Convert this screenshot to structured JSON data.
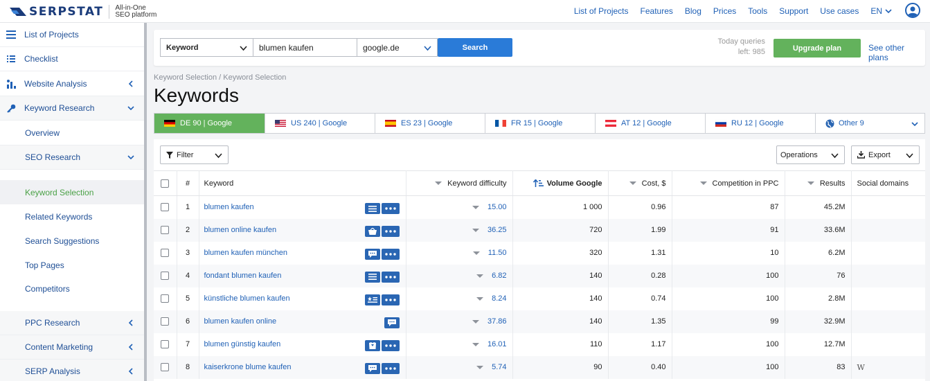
{
  "brand": {
    "name": "SERPSTAT",
    "tagline_1": "All-in-One",
    "tagline_2": "SEO platform"
  },
  "topnav": {
    "items": [
      "List of Projects",
      "Features",
      "Blog",
      "Prices",
      "Tools",
      "Support",
      "Use cases"
    ],
    "lang": "EN"
  },
  "sidebar": {
    "items": [
      {
        "label": "List of Projects"
      },
      {
        "label": "Checklist"
      },
      {
        "label": "Website Analysis"
      },
      {
        "label": "Keyword Research"
      },
      {
        "label": "Overview"
      },
      {
        "label": "SEO Research"
      },
      {
        "label": "Keyword Selection"
      },
      {
        "label": "Related Keywords"
      },
      {
        "label": "Search Suggestions"
      },
      {
        "label": "Top Pages"
      },
      {
        "label": "Competitors"
      },
      {
        "label": "PPC Research"
      },
      {
        "label": "Content Marketing"
      },
      {
        "label": "SERP Analysis"
      }
    ]
  },
  "search": {
    "type": "Keyword",
    "query": "blumen kaufen",
    "engine": "google.de",
    "button": "Search",
    "queries_label": "Today queries",
    "queries_left": "left: 985",
    "upgrade": "Upgrade plan",
    "other_plans": "See other plans"
  },
  "breadcrumb": "Keyword Selection / Keyword Selection",
  "title": "Keywords",
  "db_tabs": [
    {
      "label": "DE 90 | Google"
    },
    {
      "label": "US 240 | Google"
    },
    {
      "label": "ES 23 | Google"
    },
    {
      "label": "FR 15 | Google"
    },
    {
      "label": "AT 12 | Google"
    },
    {
      "label": "RU 12 | Google"
    },
    {
      "label": "Other 9"
    }
  ],
  "toolbar": {
    "filter": "Filter",
    "operations": "Operations",
    "export": "Export"
  },
  "columns": {
    "num": "#",
    "keyword": "Keyword",
    "kd": "Keyword difficulty",
    "volume": "Volume Google",
    "cost": "Cost, $",
    "competition": "Competition in PPC",
    "results": "Results",
    "social": "Social domains"
  },
  "rows": [
    {
      "n": "1",
      "keyword": "blumen kaufen",
      "kd": "15.00",
      "volume": "1 000",
      "cost": "0.96",
      "competition": "87",
      "results": "45.2M",
      "social": "",
      "features": [
        "list-icon",
        "more-icon"
      ]
    },
    {
      "n": "2",
      "keyword": "blumen online kaufen",
      "kd": "36.25",
      "volume": "720",
      "cost": "1.99",
      "competition": "91",
      "results": "33.6M",
      "social": "",
      "features": [
        "basket-icon",
        "more-icon"
      ]
    },
    {
      "n": "3",
      "keyword": "blumen kaufen münchen",
      "kd": "11.50",
      "volume": "320",
      "cost": "1.31",
      "competition": "10",
      "results": "6.2M",
      "social": "",
      "features": [
        "comment-icon",
        "more-icon"
      ]
    },
    {
      "n": "4",
      "keyword": "fondant blumen kaufen",
      "kd": "6.82",
      "volume": "140",
      "cost": "0.28",
      "competition": "100",
      "results": "76",
      "social": "",
      "features": [
        "list-icon",
        "more-icon"
      ]
    },
    {
      "n": "5",
      "keyword": "künstliche blumen kaufen",
      "kd": "8.24",
      "volume": "140",
      "cost": "0.74",
      "competition": "100",
      "results": "2.8M",
      "social": "",
      "features": [
        "star-list-icon",
        "more-icon"
      ]
    },
    {
      "n": "6",
      "keyword": "blumen kaufen online",
      "kd": "37.86",
      "volume": "140",
      "cost": "1.35",
      "competition": "99",
      "results": "32.9M",
      "social": "",
      "features": [
        "comment-icon"
      ]
    },
    {
      "n": "7",
      "keyword": "blumen günstig kaufen",
      "kd": "16.01",
      "volume": "110",
      "cost": "1.17",
      "competition": "100",
      "results": "12.7M",
      "social": "",
      "features": [
        "shirt-icon",
        "more-icon"
      ]
    },
    {
      "n": "8",
      "keyword": "kaiserkrone blume kaufen",
      "kd": "5.74",
      "volume": "90",
      "cost": "0.40",
      "competition": "100",
      "results": "83",
      "social": "W",
      "features": [
        "comment-icon",
        "more-icon"
      ]
    }
  ]
}
